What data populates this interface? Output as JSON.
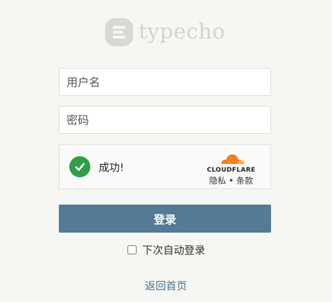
{
  "brand": {
    "logo_text": "typecho"
  },
  "form": {
    "username_placeholder": "用户名",
    "password_placeholder": "密码"
  },
  "captcha": {
    "status_text": "成功!",
    "provider_name": "CLOUDFLARE",
    "privacy_label": "隐私",
    "separator": " • ",
    "terms_label": "条款",
    "success_color": "#2f9e44",
    "cloud_colors": [
      "#f48120",
      "#faad3f"
    ]
  },
  "actions": {
    "login_label": "登录",
    "login_color": "#547a95",
    "remember_label": "下次自动登录",
    "back_label": "返回首页"
  },
  "icons": {
    "logo": "typecho-logo-icon",
    "success": "checkmark-circle-icon",
    "provider": "cloudflare-cloud-icon"
  }
}
